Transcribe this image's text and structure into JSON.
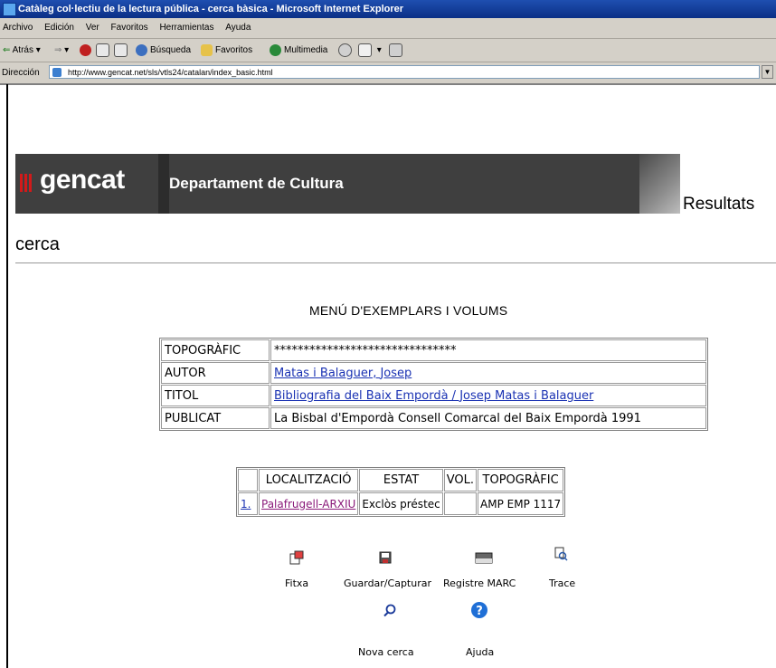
{
  "window": {
    "title": "Catàleg col·lectiu de la lectura pública - cerca bàsica - Microsoft Internet Explorer"
  },
  "menubar": [
    "Archivo",
    "Edición",
    "Ver",
    "Favoritos",
    "Herramientas",
    "Ayuda"
  ],
  "toolbar": {
    "back": "Atrás",
    "search": "Búsqueda",
    "favorites": "Favoritos",
    "multimedia": "Multimedia"
  },
  "address": {
    "label": "Dirección",
    "url": "http://www.gencat.net/sls/vtls24/catalan/index_basic.html"
  },
  "banner": {
    "logo": "gencat",
    "department": "Departament de Cultura"
  },
  "page": {
    "results_label": "Resultats",
    "search_label": "cerca",
    "menu_title": "MENÚ D'EXEMPLARS I VOLUMS"
  },
  "record": [
    {
      "label": "TOPOGRÀFIC",
      "value": "*******************************",
      "link": false
    },
    {
      "label": "AUTOR",
      "value": "Matas i Balaguer, Josep",
      "link": true
    },
    {
      "label": "TITOL",
      "value": "Bibliografia del Baix Empordà / Josep Matas i Balaguer",
      "link": true
    },
    {
      "label": "PUBLICAT",
      "value": "La Bisbal d'Empordà Consell Comarcal del Baix Empordà 1991",
      "link": false
    }
  ],
  "items_table": {
    "headers": [
      "LOCALITZACIÓ",
      "ESTAT",
      "VOL.",
      "TOPOGRÀFIC"
    ],
    "rows": [
      {
        "num": "1.",
        "location": "Palafrugell-ARXIU",
        "status": "Exclòs préstec",
        "vol": "",
        "topographic": "AMP EMP 1117"
      }
    ]
  },
  "actions": {
    "fitxa": "Fitxa",
    "guardar": "Guardar/Capturar",
    "marc": "Registre MARC",
    "trace": "Trace",
    "nova_cerca": "Nova cerca",
    "ajuda": "Ajuda"
  }
}
